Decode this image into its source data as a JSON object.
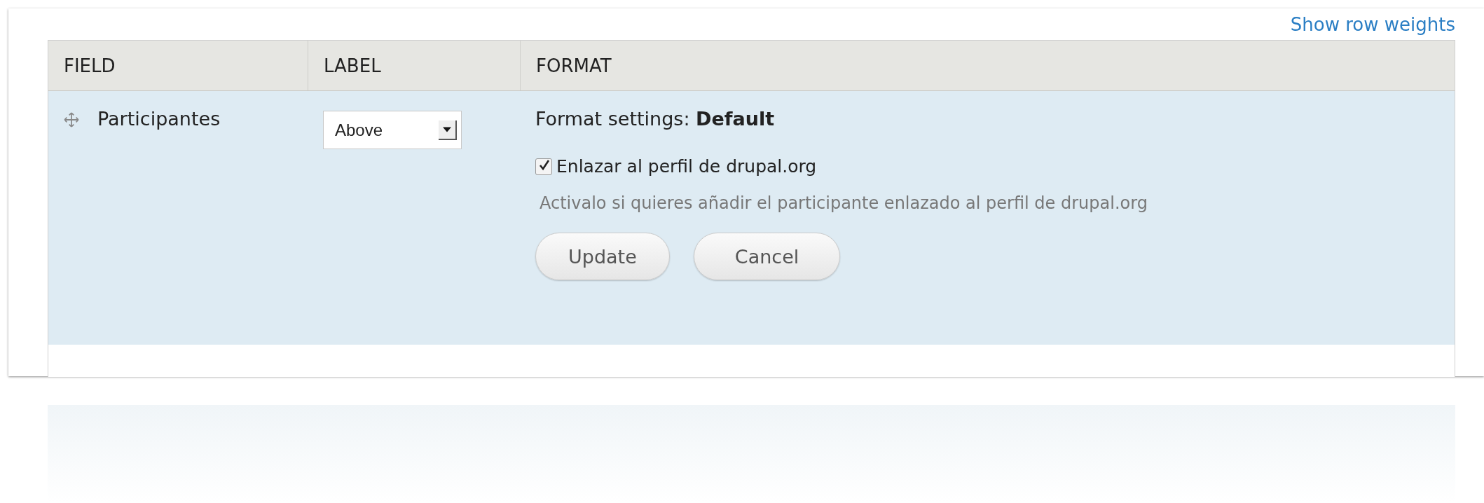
{
  "link": "Show row weights",
  "table": {
    "columns": [
      "FIELD",
      "LABEL",
      "FORMAT"
    ],
    "row": {
      "field": "Participantes",
      "label_select": "Above",
      "format": {
        "summary": "Format settings: **Default**",
        "checkbox": {
          "label": "Enlazar al perfil de drupal.org",
          "checked": true
        },
        "description": "Activalo si quieres añadir el participante enlazado al perfil de drupal.org",
        "buttons": [
          "Update",
          "Cancel"
        ]
      }
    }
  }
}
